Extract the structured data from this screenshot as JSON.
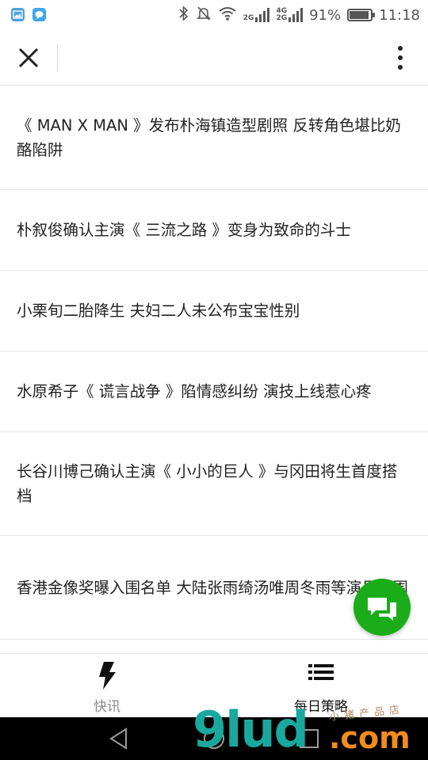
{
  "status_bar": {
    "network_top": "2G",
    "network_4g": "4G",
    "network_2g": "2G",
    "battery": "91%",
    "battery_level": 0.91,
    "time": "11:18"
  },
  "header": {
    "close_icon": "close-icon",
    "more_icon": "more-vertical-icon"
  },
  "news": [
    {
      "title": "《 MAN X MAN 》发布朴海镇造型剧照 反转角色堪比奶酪陷阱"
    },
    {
      "title": "朴叙俊确认主演《 三流之路 》变身为致命的斗士"
    },
    {
      "title": "小栗旬二胎降生 夫妇二人未公布宝宝性别"
    },
    {
      "title": "水原希子《 谎言战争 》陷情感纠纷 演技上线惹心疼"
    },
    {
      "title": "长谷川博己确认主演《 小小的巨人 》与冈田将生首度搭档"
    },
    {
      "title": "香港金像奖曝入围名单 大陆张雨绮汤唯周冬雨等演员入围"
    }
  ],
  "fab": {
    "icon": "chat-bubbles-icon",
    "color": "#1aad19"
  },
  "tabs": [
    {
      "label": "快讯",
      "icon": "lightning-icon"
    },
    {
      "label": "每日策略",
      "icon": "list-icon"
    }
  ],
  "watermark": {
    "main": "9lud",
    "suffix": ".com",
    "small": "小猪产品店"
  }
}
